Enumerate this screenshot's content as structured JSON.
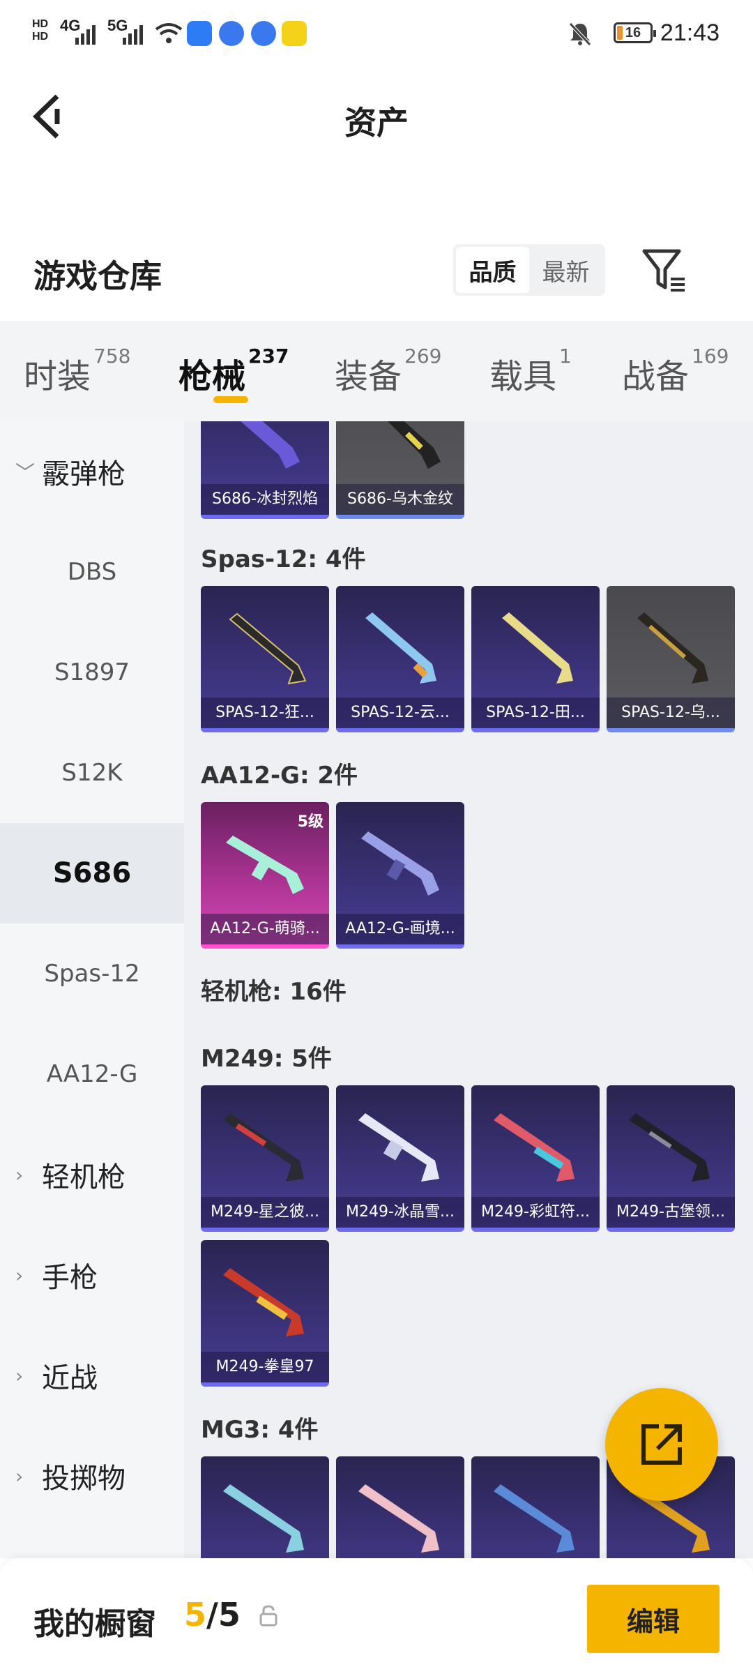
{
  "status_bar": {
    "time": "21:43",
    "battery": "16",
    "network": [
      "4G",
      "5G"
    ],
    "icons": [
      "hd-icon",
      "signal-icon",
      "wifi-icon",
      "app-icon",
      "mute-bell-icon",
      "battery-icon"
    ]
  },
  "header": {
    "title": "资产"
  },
  "warehouse": {
    "title": "游戏仓库",
    "sort_options": [
      "品质",
      "最新"
    ],
    "active_sort": "品质"
  },
  "tabs": [
    {
      "label": "时装",
      "count": "758"
    },
    {
      "label": "枪械",
      "count": "237"
    },
    {
      "label": "装备",
      "count": "269"
    },
    {
      "label": "载具",
      "count": "1"
    },
    {
      "label": "战备",
      "count": "169"
    }
  ],
  "active_tab": "枪械",
  "sidebar": [
    {
      "label": "霰弹枪",
      "type": "group",
      "expanded": true
    },
    {
      "label": "DBS",
      "type": "item"
    },
    {
      "label": "S1897",
      "type": "item"
    },
    {
      "label": "S12K",
      "type": "item"
    },
    {
      "label": "S686",
      "type": "item",
      "active": true
    },
    {
      "label": "Spas-12",
      "type": "item"
    },
    {
      "label": "AA12-G",
      "type": "item"
    },
    {
      "label": "轻机枪",
      "type": "group"
    },
    {
      "label": "手枪",
      "type": "group"
    },
    {
      "label": "近战",
      "type": "group"
    },
    {
      "label": "投掷物",
      "type": "group"
    }
  ],
  "sections": {
    "s686_cards": [
      "S686-冰封烈焰",
      "S686-乌木金纹"
    ],
    "spas_header": "Spas-12: 4件",
    "spas_cards": [
      "SPAS-12-狂...",
      "SPAS-12-云...",
      "SPAS-12-田...",
      "SPAS-12-乌..."
    ],
    "aa12_header": "AA12-G: 2件",
    "aa12_cards": [
      "AA12-G-萌骑...",
      "AA12-G-画境..."
    ],
    "aa12_level": "5级",
    "lmg_header": "轻机枪: 16件",
    "m249_header": "M249: 5件",
    "m249_cards": [
      "M249-星之彼...",
      "M249-冰晶雪...",
      "M249-彩虹符...",
      "M249-古堡领...",
      "M249-拳皇97"
    ],
    "mg3_header": "MG3: 4件"
  },
  "showcase": {
    "title": "我的橱窗",
    "current": "5",
    "separator": "/",
    "total": "5",
    "edit_label": "编辑"
  },
  "colors": {
    "accent": "#f5b400",
    "card_purple": "#3e3580",
    "card_pink": "#b03596"
  }
}
